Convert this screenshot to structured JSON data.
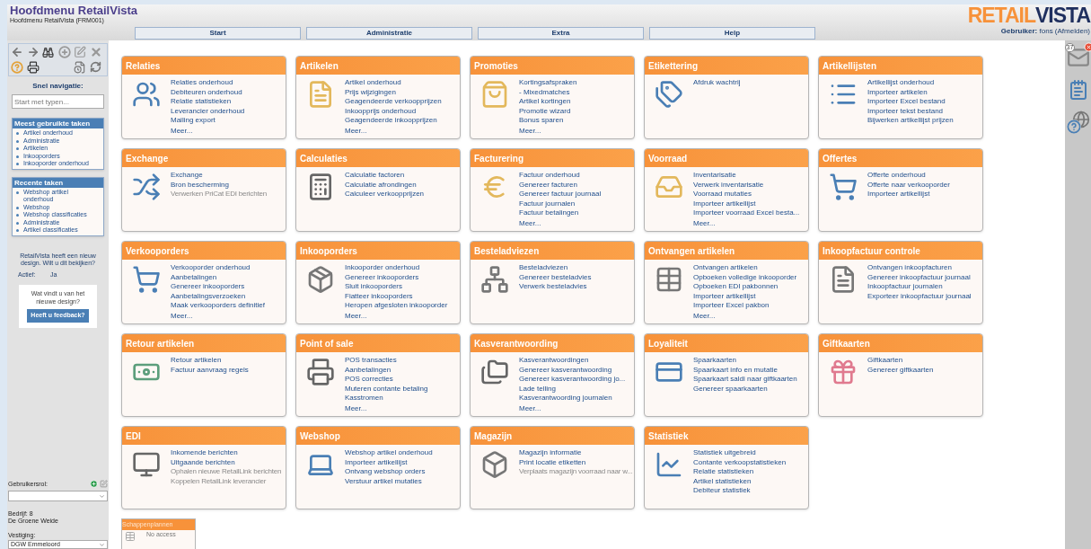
{
  "header": {
    "title": "Hoofdmenu RetailVista",
    "subtitle": "Hoofdmenu RetailVista (FRM001)",
    "logo": {
      "first": "RETAIL",
      "second": "VISTA"
    },
    "user": "**Gebruiker:** fons (Afmelden)"
  },
  "nav": [
    {
      "label": "Start"
    },
    {
      "label": "Administratie"
    },
    {
      "label": "Extra"
    },
    {
      "label": "Help"
    }
  ],
  "sidebar": {
    "quick_nav": {
      "label": "Snel navigatie:",
      "placeholder": "Start met typen..."
    },
    "most_used": {
      "title": "Meest gebruikte taken",
      "items": [
        "Artikel onderhoud",
        "Administratie",
        "Artikelen",
        "Inkooporders",
        "Inkooporder onderhoud"
      ]
    },
    "recent": {
      "title": "Recente taken",
      "items": [
        "Webshop artikel onderhoud",
        "Webshop",
        "Webshop classificaties",
        "Administratie",
        "Artikel classificaties"
      ]
    },
    "notice": "RetailVista heeft een nieuw design. Wilt u dit bekijken?",
    "active": {
      "label": "Actief:",
      "value": "Ja"
    },
    "feedback": {
      "question": "Wat vindt u van het nieuwe design?",
      "button": "Heeft u feedback?"
    },
    "role": {
      "label": "Gebruikersrol:"
    },
    "company": {
      "line": "Bedrijf: 8",
      "name": "De Groene Weide"
    },
    "branch": {
      "label": "Vestiging:",
      "value": "DGW Emmeloord"
    }
  },
  "tiles": [
    {
      "title": "Relaties",
      "links": [
        {
          "text": "Relaties onderhoud",
          "disabled": false
        },
        {
          "text": "Debiteuren onderhoud",
          "disabled": false
        },
        {
          "text": "Relatie statistieken",
          "disabled": false
        },
        {
          "text": "Leverancier onderhoud",
          "disabled": false
        },
        {
          "text": "Mailing export",
          "disabled": false
        }
      ],
      "more": "Meer..."
    },
    {
      "title": "Artikelen",
      "links": [
        {
          "text": "Artikel onderhoud",
          "disabled": false
        },
        {
          "text": "Prijs wijzigingen",
          "disabled": false
        },
        {
          "text": "Geagendeerde verkoopprijzen",
          "disabled": false
        },
        {
          "text": "Inkoopprijs onderhoud",
          "disabled": false
        },
        {
          "text": "Geagendeerde inkoopprijzen",
          "disabled": false
        }
      ],
      "more": "Meer..."
    },
    {
      "title": "Promoties",
      "links": [
        {
          "text": "Kortingsafspraken",
          "disabled": false
        },
        {
          "text": "- Mixedmatches",
          "disabled": false
        },
        {
          "text": "Artikel kortingen",
          "disabled": false
        },
        {
          "text": "Promotie wizard",
          "disabled": false
        },
        {
          "text": "Bonus sparen",
          "disabled": false
        }
      ],
      "more": "Meer..."
    },
    {
      "title": "Etikettering",
      "links": [
        {
          "text": "Afdruk wachtrij",
          "disabled": false
        }
      ]
    },
    {
      "title": "Artikellijsten",
      "links": [
        {
          "text": "Artikellijst onderhoud",
          "disabled": false
        },
        {
          "text": "Importeer artikelen",
          "disabled": false
        },
        {
          "text": "Importeer Excel bestand",
          "disabled": false
        },
        {
          "text": "Importeer tekst bestand",
          "disabled": false
        },
        {
          "text": "Bijwerken artikellijst prijzen",
          "disabled": false
        }
      ]
    },
    {
      "title": "Exchange",
      "links": [
        {
          "text": "Exchange",
          "disabled": false
        },
        {
          "text": "Bron bescherming",
          "disabled": false
        },
        {
          "text": "Verwerken PriCat EDI berichten",
          "disabled": true
        }
      ]
    },
    {
      "title": "Calculaties",
      "links": [
        {
          "text": "Calculatie factoren",
          "disabled": false
        },
        {
          "text": "Calculatie afrondingen",
          "disabled": false
        },
        {
          "text": "Calculeer verkoopprijzen",
          "disabled": false
        }
      ]
    },
    {
      "title": "Facturering",
      "links": [
        {
          "text": "Factuur onderhoud",
          "disabled": false
        },
        {
          "text": "Genereer facturen",
          "disabled": false
        },
        {
          "text": "Genereer factuur journaal",
          "disabled": false
        },
        {
          "text": "Factuur journalen",
          "disabled": false
        },
        {
          "text": "Factuur betalingen",
          "disabled": false
        }
      ],
      "more": "Meer..."
    },
    {
      "title": "Voorraad",
      "links": [
        {
          "text": "Inventarisatie",
          "disabled": false
        },
        {
          "text": "Verwerk inventarisatie",
          "disabled": false
        },
        {
          "text": "Voorraad mutaties",
          "disabled": false
        },
        {
          "text": "Importeer artikellijst",
          "disabled": false
        },
        {
          "text": "Importeer voorraad Excel besta...",
          "disabled": false
        }
      ],
      "more": "Meer..."
    },
    {
      "title": "Offertes",
      "links": [
        {
          "text": "Offerte onderhoud",
          "disabled": false
        },
        {
          "text": "Offerte naar verkooporder",
          "disabled": false
        },
        {
          "text": "Importeer artikellijst",
          "disabled": false
        }
      ]
    },
    {
      "title": "Verkooporders",
      "links": [
        {
          "text": "Verkooporder onderhoud",
          "disabled": false
        },
        {
          "text": "Aanbetalingen",
          "disabled": false
        },
        {
          "text": "Genereer inkooporders",
          "disabled": false
        },
        {
          "text": "Aanbetalingsverzoeken",
          "disabled": false
        },
        {
          "text": "Maak verkooporders definitief",
          "disabled": false
        }
      ],
      "more": "Meer..."
    },
    {
      "title": "Inkooporders",
      "links": [
        {
          "text": "Inkooporder onderhoud",
          "disabled": false
        },
        {
          "text": "Genereer inkooporders",
          "disabled": false
        },
        {
          "text": "Sluit inkooporders",
          "disabled": false
        },
        {
          "text": "Fiatteer inkooporders",
          "disabled": false
        },
        {
          "text": "Heropen afgesloten inkooporder",
          "disabled": false
        }
      ],
      "more": "Meer..."
    },
    {
      "title": "Besteladviezen",
      "links": [
        {
          "text": "Besteladviezen",
          "disabled": false
        },
        {
          "text": "Genereer besteladvies",
          "disabled": false
        },
        {
          "text": "Verwerk besteladvies",
          "disabled": false
        }
      ]
    },
    {
      "title": "Ontvangen artikelen",
      "links": [
        {
          "text": "Ontvangen artikelen",
          "disabled": false
        },
        {
          "text": "Opboeken volledige inkooporder",
          "disabled": false
        },
        {
          "text": "Opboeken EDI pakbonnen",
          "disabled": false
        },
        {
          "text": "Importeer artikellijst",
          "disabled": false
        },
        {
          "text": "Importeer Excel pakbon",
          "disabled": false
        }
      ],
      "more": "Meer..."
    },
    {
      "title": "Inkoopfactuur controle",
      "links": [
        {
          "text": "Ontvangen inkoopfacturen",
          "disabled": false
        },
        {
          "text": "Genereer inkoopfactuur journaal",
          "disabled": false
        },
        {
          "text": "Inkoopfactuur journalen",
          "disabled": false
        },
        {
          "text": "Exporteer inkoopfactuur journaal",
          "disabled": false
        }
      ]
    },
    {
      "title": "Retour artikelen",
      "links": [
        {
          "text": "Retour artikelen",
          "disabled": false
        },
        {
          "text": "Factuur aanvraag regels",
          "disabled": false
        }
      ]
    },
    {
      "title": "Point of sale",
      "links": [
        {
          "text": "POS transacties",
          "disabled": false
        },
        {
          "text": "Aanbetalingen",
          "disabled": false
        },
        {
          "text": "POS correcties",
          "disabled": false
        },
        {
          "text": "Muteren contante betaling",
          "disabled": false
        },
        {
          "text": "Kasstromen",
          "disabled": false
        }
      ],
      "more": "Meer..."
    },
    {
      "title": "Kasverantwoording",
      "links": [
        {
          "text": "Kasverantwoordingen",
          "disabled": false
        },
        {
          "text": "Genereer kasverantwoording",
          "disabled": false
        },
        {
          "text": "Genereer kasverantwoording jo...",
          "disabled": false
        },
        {
          "text": "Lade telling",
          "disabled": false
        },
        {
          "text": "Kasverantwoording journalen",
          "disabled": false
        }
      ],
      "more": "Meer..."
    },
    {
      "title": "Loyaliteit",
      "links": [
        {
          "text": "Spaarkaarten",
          "disabled": false
        },
        {
          "text": "Spaarkaart info en mutatie",
          "disabled": false
        },
        {
          "text": "Spaarkaart saldi naar giftkaarten",
          "disabled": false
        },
        {
          "text": "Genereer spaarkaarten",
          "disabled": false
        }
      ]
    },
    {
      "title": "Giftkaarten",
      "links": [
        {
          "text": "Giftkaarten",
          "disabled": false
        },
        {
          "text": "Genereer giftkaarten",
          "disabled": false
        }
      ]
    },
    {
      "title": "EDI",
      "links": [
        {
          "text": "Inkomende berichten",
          "disabled": false
        },
        {
          "text": "Uitgaande berichten",
          "disabled": false
        },
        {
          "text": "Ophalen nieuwe RetailLink berichten",
          "disabled": true
        },
        {
          "text": "Koppelen RetailLink leverancier",
          "disabled": true
        }
      ]
    },
    {
      "title": "Webshop",
      "links": [
        {
          "text": "Webshop artikel onderhoud",
          "disabled": false
        },
        {
          "text": "Importeer artikellijst",
          "disabled": false
        },
        {
          "text": "Ontvang webshop orders",
          "disabled": false
        },
        {
          "text": "Verstuur artikel mutaties",
          "disabled": false
        }
      ]
    },
    {
      "title": "Magazijn",
      "links": [
        {
          "text": "Magazijn informatie",
          "disabled": false
        },
        {
          "text": "Print locatie etiketten",
          "disabled": false
        },
        {
          "text": "Verplaats magazijn voorraad naar w...",
          "disabled": true
        }
      ]
    },
    {
      "title": "Statistiek",
      "links": [
        {
          "text": "Statistiek uitgebreid",
          "disabled": false
        },
        {
          "text": "Contante verkoopstatistieken",
          "disabled": false
        },
        {
          "text": "Relatie statistieken",
          "disabled": false
        },
        {
          "text": "Artikel statistieken",
          "disabled": false
        },
        {
          "text": "Debiteur statistiek",
          "disabled": false
        }
      ]
    }
  ],
  "restricted_tile": {
    "title": "Schappenplannen",
    "note": "No access"
  },
  "side_tools": {
    "mail_count": "37"
  }
}
